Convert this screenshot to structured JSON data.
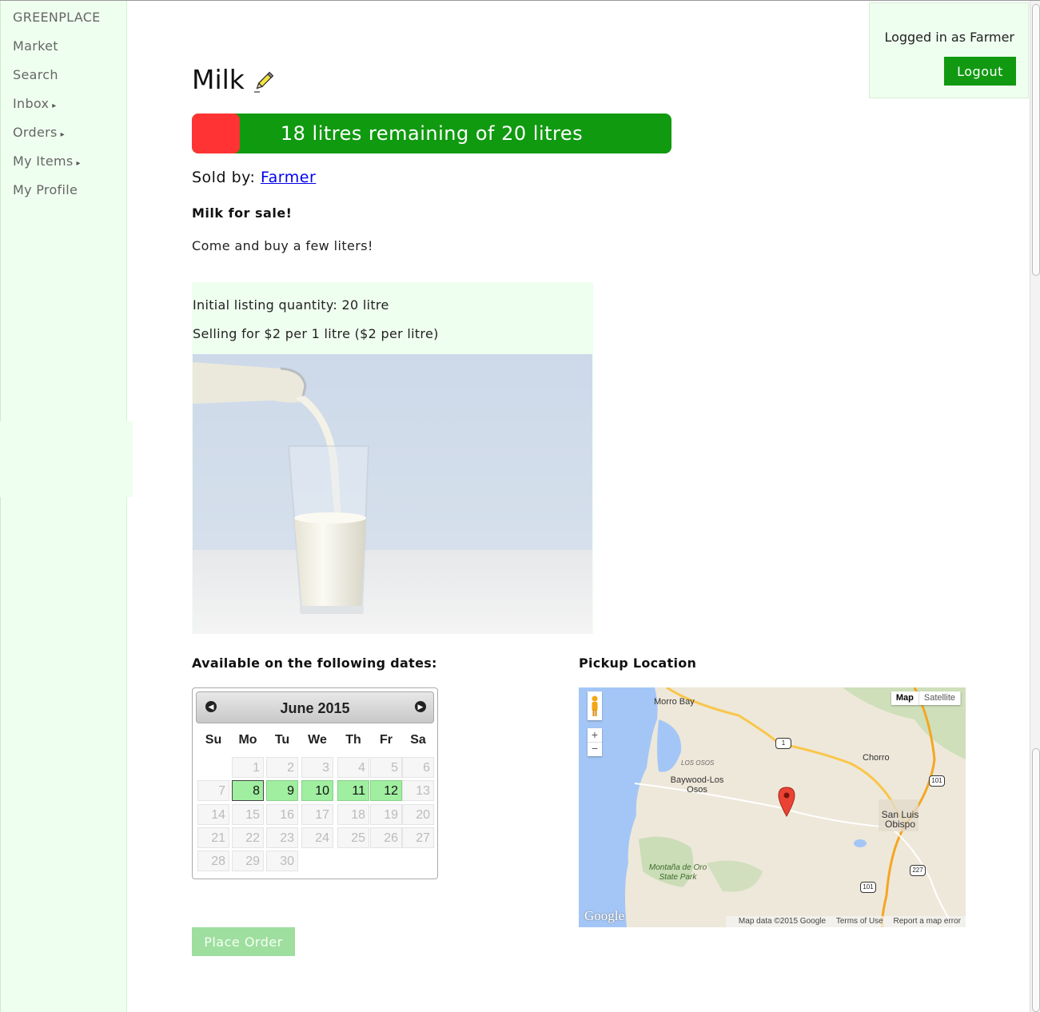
{
  "nav": {
    "brand": "GREENPLACE",
    "items": [
      {
        "label": "Market",
        "has_arrow": false
      },
      {
        "label": "Search",
        "has_arrow": false
      },
      {
        "label": "Inbox",
        "has_arrow": true
      },
      {
        "label": "Orders",
        "has_arrow": true
      },
      {
        "label": "My Items",
        "has_arrow": true
      },
      {
        "label": "My Profile",
        "has_arrow": false
      }
    ],
    "arrow_glyph": "▸"
  },
  "session": {
    "status": "Logged in as Farmer",
    "logout_label": "Logout"
  },
  "listing": {
    "title": "Milk",
    "progress_text": "18 litres remaining of 20 litres",
    "remaining": 18,
    "total": 20,
    "sold_by_label": "Sold by:",
    "seller": "Farmer",
    "headline": "Milk for sale!",
    "description": "Come and buy a few liters!",
    "initial_quantity": "Initial listing quantity: 20 litre",
    "price": "Selling for $2 per 1 litre ($2 per litre)"
  },
  "dates": {
    "heading": "Available on the following dates:",
    "month_title": "June 2015",
    "weekdays": [
      "Su",
      "Mo",
      "Tu",
      "We",
      "Th",
      "Fr",
      "Sa"
    ],
    "weeks": [
      [
        null,
        1,
        2,
        3,
        4,
        5,
        6
      ],
      [
        7,
        8,
        9,
        10,
        11,
        12,
        13
      ],
      [
        14,
        15,
        16,
        17,
        18,
        19,
        20
      ],
      [
        21,
        22,
        23,
        24,
        25,
        26,
        27
      ],
      [
        28,
        29,
        30,
        null,
        null,
        null,
        null
      ]
    ],
    "available": [
      8,
      9,
      10,
      11,
      12
    ],
    "selected": 8
  },
  "pickup": {
    "heading": "Pickup Location",
    "map_type_buttons": [
      "Map",
      "Satellite"
    ],
    "labels": [
      "Morro Bay",
      "Chorro",
      "LOS OSOS",
      "Baywood-Los Osos",
      "San Luis Obispo",
      "Montaña de Oro State Park"
    ],
    "route_shields": [
      "1",
      "101",
      "227",
      "101"
    ],
    "attribution": "Map data ©2015 Google",
    "terms": "Terms of Use",
    "report": "Report a map error",
    "logo": "Google"
  },
  "actions": {
    "place_order": "Place Order"
  },
  "colors": {
    "sidebar_bg": "#efffef",
    "brand_green": "#119911",
    "used_red": "#ff3333",
    "available_day": "#a0eea0",
    "disabled_button": "#9ede9e"
  }
}
